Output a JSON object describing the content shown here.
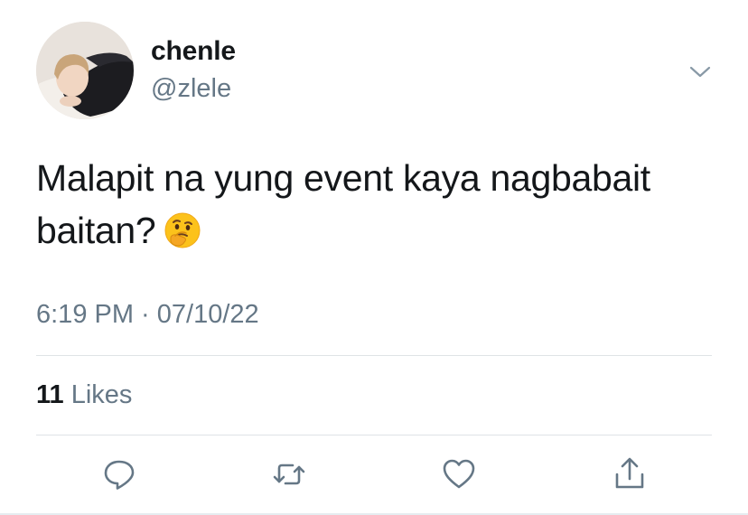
{
  "user": {
    "display_name": "chenle",
    "handle": "@zlele",
    "avatar_icon": "profile-photo"
  },
  "tweet": {
    "text_line1": "Malapit na yung event kaya nagbabait",
    "text_line2": "baitan?",
    "emoji": "thinking-face",
    "timestamp": "6:19 PM · 07/10/22"
  },
  "stats": {
    "likes_count": "11",
    "likes_label": "Likes"
  },
  "actions": [
    {
      "icon": "reply-icon"
    },
    {
      "icon": "retweet-icon"
    },
    {
      "icon": "like-icon"
    },
    {
      "icon": "share-icon"
    }
  ],
  "colors": {
    "text_primary": "#14171a",
    "text_secondary": "#657786",
    "icon": "#657786",
    "divider": "#dfe3e6"
  }
}
